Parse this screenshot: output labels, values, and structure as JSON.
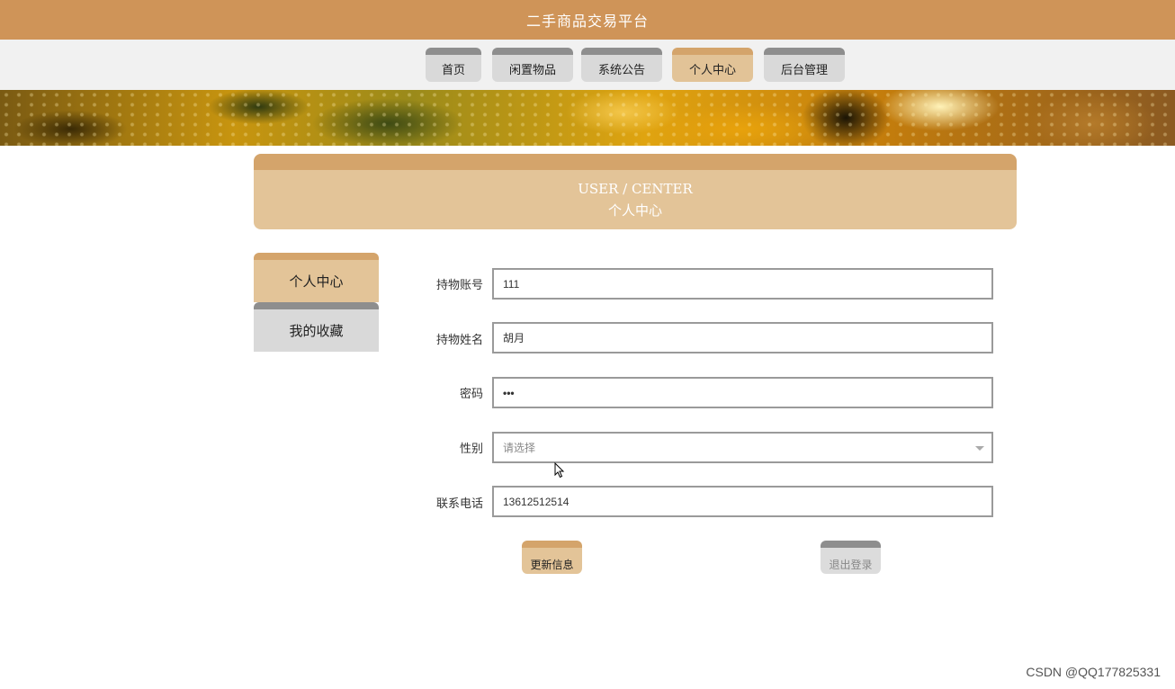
{
  "app": {
    "title": "二手商品交易平台"
  },
  "nav": {
    "items": [
      {
        "label": "首页"
      },
      {
        "label": "闲置物品"
      },
      {
        "label": "系统公告"
      },
      {
        "label": "个人中心",
        "active": true
      },
      {
        "label": "后台管理"
      }
    ]
  },
  "banner": {
    "kind": "golden-droplets-image"
  },
  "section": {
    "title_en": "USER / CENTER",
    "title_cn": "个人中心"
  },
  "sidebar": {
    "items": [
      {
        "label": "个人中心",
        "active": true
      },
      {
        "label": "我的收藏"
      }
    ]
  },
  "form": {
    "fields": [
      {
        "label": "持物账号",
        "value": "111"
      },
      {
        "label": "持物姓名",
        "value": "胡月"
      },
      {
        "label": "密码",
        "value": "•••"
      },
      {
        "label": "性别",
        "value": "",
        "placeholder": "请选择"
      },
      {
        "label": "联系电话",
        "value": "13612512514"
      }
    ],
    "update_button": "更新信息",
    "logout_button": "退出登录"
  },
  "watermark": "CSDN @QQ177825331",
  "colors": {
    "brand": "#cf9458",
    "accent_light": "#e3c498",
    "accent_top": "#d4a46b",
    "inactive": "#d9d9d9",
    "inactive_top": "#8e8e8e"
  }
}
